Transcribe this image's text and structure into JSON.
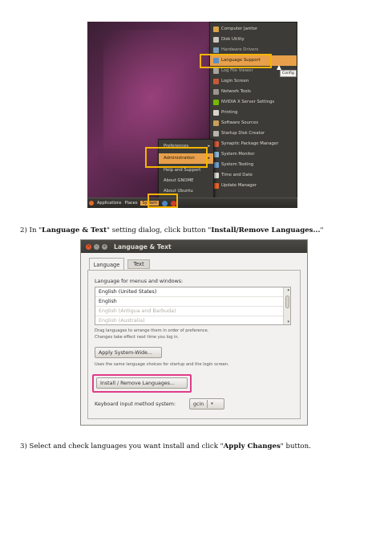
{
  "screenshot1": {
    "menu": [
      {
        "label": "Computer Janitor",
        "icon": "broom-icon",
        "color": "#d9a34b"
      },
      {
        "label": "Disk Utility",
        "icon": "disk-icon",
        "color": "#c9c6bf"
      },
      {
        "label": "Hardware Drivers",
        "icon": "chip-icon",
        "color": "#7a9bb8"
      },
      {
        "label": "Language Support",
        "icon": "globe-icon",
        "color": "#5b8fc7"
      },
      {
        "label": "Log File Viewer",
        "icon": "log-icon",
        "color": "#a8a39a"
      },
      {
        "label": "Login Screen",
        "icon": "login-icon",
        "color": "#c45a3b"
      },
      {
        "label": "Network Tools",
        "icon": "network-icon",
        "color": "#9a968f"
      },
      {
        "label": "NVIDIA X Server Settings",
        "icon": "nvidia-icon",
        "color": "#76b900"
      },
      {
        "label": "Printing",
        "icon": "printer-icon",
        "color": "#d8d4cc"
      },
      {
        "label": "Software Sources",
        "icon": "package-icon",
        "color": "#c8a05b"
      },
      {
        "label": "Startup Disk Creator",
        "icon": "usb-icon",
        "color": "#b8b4ad"
      },
      {
        "label": "Synaptic Package Manager",
        "icon": "synaptic-icon",
        "color": "#d85b3b"
      },
      {
        "label": "System Monitor",
        "icon": "monitor-icon",
        "color": "#8fb5d8"
      },
      {
        "label": "System Testing",
        "icon": "testing-icon",
        "color": "#6f9fd0"
      },
      {
        "label": "Time and Date",
        "icon": "clock-icon",
        "color": "#e0ddd5"
      },
      {
        "label": "Update Manager",
        "icon": "update-icon",
        "color": "#e8642e"
      }
    ],
    "tooltip": "Config",
    "system_menu": [
      {
        "label": "Preferences"
      },
      {
        "label": "Administration"
      },
      {
        "label": "Help and Support"
      },
      {
        "label": "About GNOME"
      },
      {
        "label": "About Ubuntu"
      }
    ],
    "panel": {
      "applications": "Applications",
      "places": "Places",
      "system": "System"
    }
  },
  "steps": {
    "step2": {
      "prefix": "2) In \"",
      "dialog_name": "Language & Text",
      "middle": "\" setting dialog, click button \"",
      "button_name": "Install/Remove Languages...",
      "suffix": "\""
    },
    "step3": {
      "prefix": "3) Select and check languages you want install and click \"",
      "button_name": "Apply Changes",
      "suffix": "\" button."
    }
  },
  "dialog": {
    "title": "Language & Text",
    "tabs": [
      "Language",
      "Text"
    ],
    "menus_label": "Language for menus and windows:",
    "languages": [
      {
        "label": "English (United States)",
        "state": "dark"
      },
      {
        "label": "English",
        "state": "dark"
      },
      {
        "label": "English (Antigua and Barbuda)",
        "state": "grey"
      },
      {
        "label": "English (Australia)",
        "state": "grey"
      }
    ],
    "drag_hint": "Drag languages to arrange them in order of preference.",
    "effect_hint": "Changes take effect next time you log in.",
    "apply_system_wide": "Apply System-Wide...",
    "apply_hint": "Uses the same language choices for startup and the login screen.",
    "install_remove": "Install / Remove Languages...",
    "keyboard_label": "Keyboard input method system:",
    "keyboard_value": "gcin",
    "colors": {
      "highlight_box": "#e03c8a",
      "menu_highlight": "#f5b400"
    }
  }
}
